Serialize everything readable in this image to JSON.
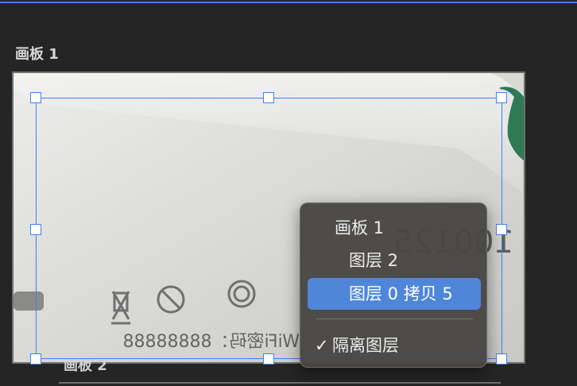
{
  "artboards": {
    "first_label": "画板 1",
    "second_label": "画板 2"
  },
  "photo_text": {
    "line1": "适用型号：100125",
    "line2": "WiFi密码：88888888"
  },
  "context_menu": {
    "items": [
      {
        "label": "画板 1",
        "selected": false
      },
      {
        "label": "图层 2",
        "selected": false
      },
      {
        "label": "图层 0 拷贝 5",
        "selected": true
      }
    ],
    "toggle": {
      "label": "隔离图层",
      "checked": true,
      "check_symbol": "✓"
    }
  },
  "colors": {
    "selection": "#3b82f6",
    "menu_highlight": "#4f86d9",
    "background": "#252525"
  }
}
